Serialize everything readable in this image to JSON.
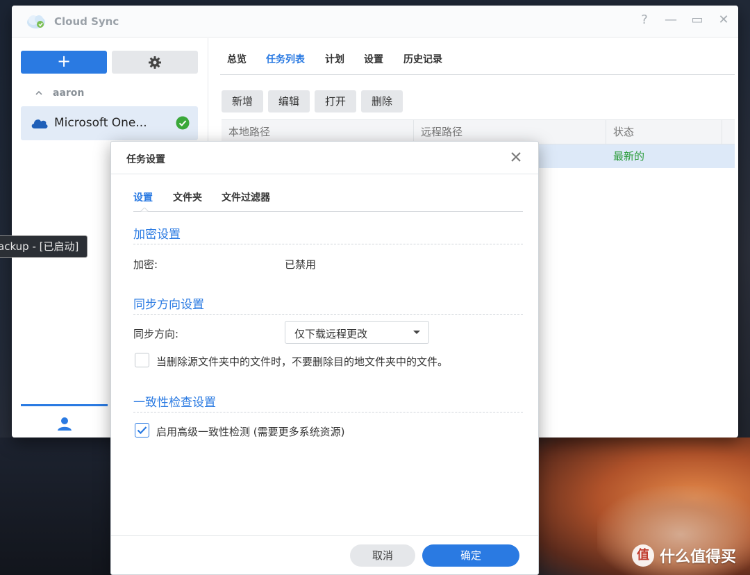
{
  "window": {
    "title": "Cloud Sync",
    "controls": [
      "?",
      "—",
      "▭",
      "✕"
    ]
  },
  "sidebar": {
    "add_label": "+",
    "account": "aaron",
    "connection": {
      "label": "Microsoft One...",
      "status": "ok"
    }
  },
  "main": {
    "tabs": [
      {
        "label": "总览",
        "active": false
      },
      {
        "label": "任务列表",
        "active": true
      },
      {
        "label": "计划",
        "active": false
      },
      {
        "label": "设置",
        "active": false
      },
      {
        "label": "历史记录",
        "active": false
      }
    ],
    "toolbar": [
      "新增",
      "编辑",
      "打开",
      "删除"
    ],
    "table": {
      "columns": [
        "本地路径",
        "远程路径",
        "状态"
      ],
      "rows": [
        {
          "local": "",
          "remote": "",
          "status": "最新的"
        }
      ]
    }
  },
  "tooltip": "ackup - [已启动]",
  "dialog": {
    "title": "任务设置",
    "tabs": [
      {
        "label": "设置",
        "active": true
      },
      {
        "label": "文件夹",
        "active": false
      },
      {
        "label": "文件过滤器",
        "active": false
      }
    ],
    "encryption": {
      "section": "加密设置",
      "label": "加密:",
      "value": "已禁用"
    },
    "sync_direction": {
      "section": "同步方向设置",
      "label": "同步方向:",
      "selected": "仅下载远程更改",
      "dont_delete_label": "当删除源文件夹中的文件时，不要删除目的地文件夹中的文件。",
      "dont_delete_checked": false
    },
    "consistency": {
      "section": "一致性检查设置",
      "label": "启用高级一致性检测 (需要更多系统资源)",
      "checked": true
    },
    "cancel_label": "取消",
    "ok_label": "确定"
  },
  "watermark": {
    "badge": "值",
    "text": "什么值得买"
  },
  "colors": {
    "accent": "#2a7ae2",
    "success": "#2a9b3a"
  }
}
